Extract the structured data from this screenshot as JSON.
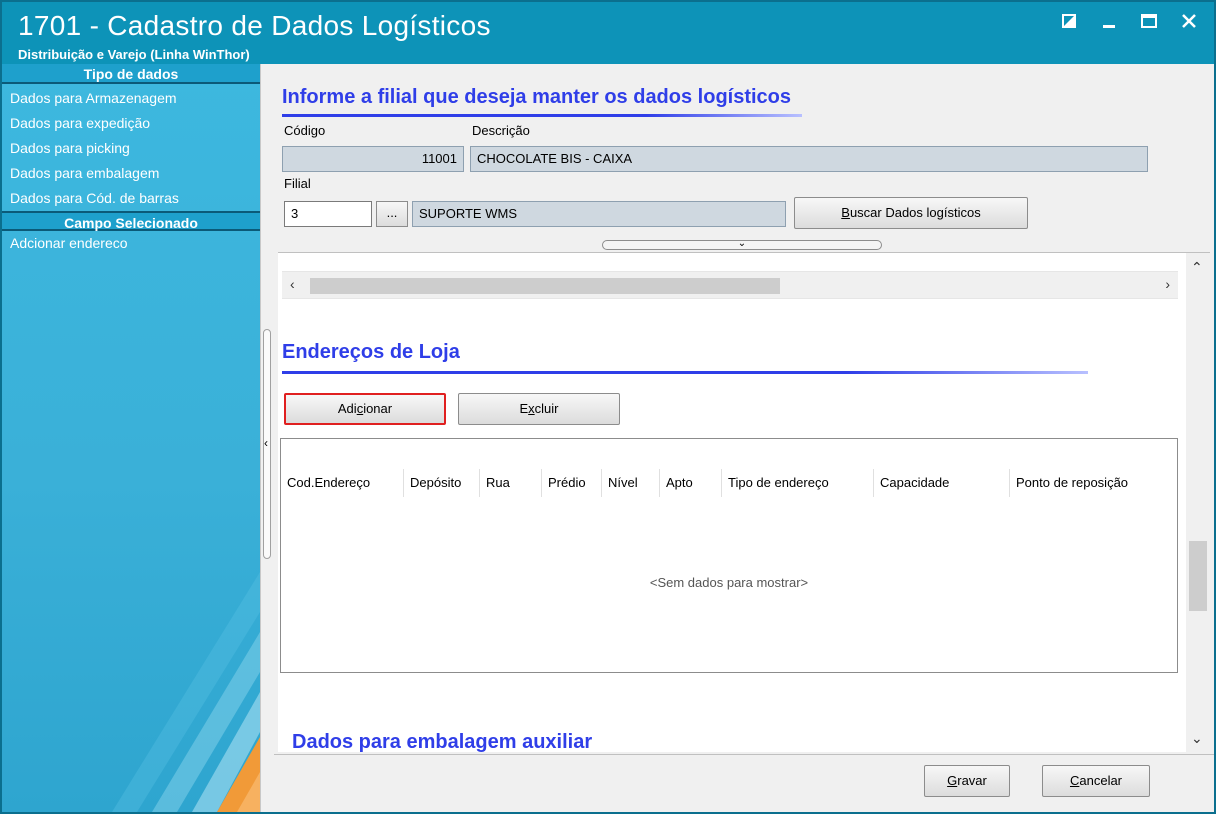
{
  "window": {
    "title": "1701 - Cadastro de Dados Logísticos",
    "subtitle": "Distribuição e Varejo (Linha WinThor)",
    "controls": [
      "restore",
      "minimize",
      "maximize",
      "close"
    ]
  },
  "sidebar": {
    "header1": "Tipo de dados",
    "items": [
      {
        "label": "Dados para Armazenagem"
      },
      {
        "label": "Dados para expedição"
      },
      {
        "label": "Dados para picking"
      },
      {
        "label": "Dados para embalagem"
      },
      {
        "label": "Dados para Cód. de barras"
      }
    ],
    "header2": "Campo Selecionado",
    "selected_items": [
      {
        "label": "Adcionar endereco"
      }
    ]
  },
  "filial_section": {
    "title": "Informe a filial que deseja manter os dados logísticos",
    "codigo_label": "Código",
    "codigo_value": "11001",
    "descricao_label": "Descrição",
    "descricao_value": "CHOCOLATE BIS  - CAIXA",
    "filial_label": "Filial",
    "filial_value": "3",
    "filial_lookup_label": "...",
    "filial_name": "SUPORTE WMS",
    "buscar_button": {
      "pre": "",
      "key": "B",
      "post": "uscar Dados logísticos"
    }
  },
  "enderecos_section": {
    "title": "Endereços de Loja",
    "add_button": {
      "pre": "Adi",
      "key": "c",
      "post": "ionar"
    },
    "delete_button": {
      "pre": "E",
      "key": "x",
      "post": "cluir"
    },
    "columns": [
      "Cod.Endereço",
      "Depósito",
      "Rua",
      "Prédio",
      "Nível",
      "Apto",
      "Tipo de endereço",
      "Capacidade",
      "Ponto de reposição"
    ],
    "empty_message": "<Sem dados para mostrar>"
  },
  "next_section": {
    "title": "Dados para embalagem auxiliar"
  },
  "footer": {
    "save_button": {
      "pre": "",
      "key": "G",
      "post": "ravar"
    },
    "cancel_button": {
      "pre": "",
      "key": "C",
      "post": "ancelar"
    }
  },
  "colors": {
    "titlebar": "#0d93b8",
    "sidebar": "#3db8df",
    "section_title": "#2f3ee8",
    "focus_border": "#e02020"
  }
}
